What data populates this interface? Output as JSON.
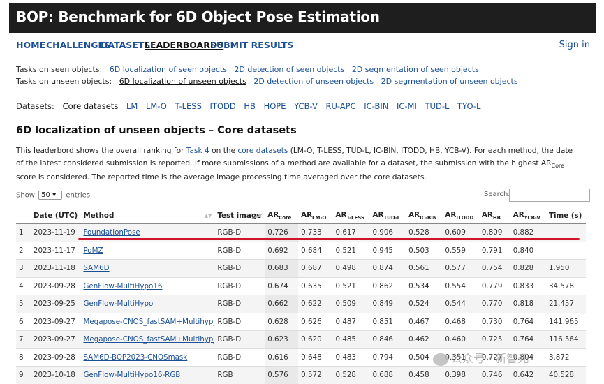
{
  "header": {
    "title": "BOP: Benchmark for 6D Object Pose Estimation"
  },
  "nav": {
    "items": [
      "HOME",
      "CHALLENGES",
      "DATASETS",
      "LEADERBOARDS",
      "SUBMIT RESULTS"
    ],
    "active": "LEADERBOARDS",
    "signin": "Sign in"
  },
  "tasks": {
    "seen_label": "Tasks on seen objects:",
    "seen": [
      "6D localization of seen objects",
      "2D detection of seen objects",
      "2D segmentation of seen objects"
    ],
    "unseen_label": "Tasks on unseen objects:",
    "unseen": [
      "6D localization of unseen objects",
      "2D detection of unseen objects",
      "2D segmentation of unseen objects"
    ]
  },
  "datasets": {
    "label": "Datasets:",
    "items": [
      "Core datasets",
      "LM",
      "LM-O",
      "T-LESS",
      "ITODD",
      "HB",
      "HOPE",
      "YCB-V",
      "RU-APC",
      "IC-BIN",
      "IC-MI",
      "TUD-L",
      "TYO-L"
    ]
  },
  "section_title": "6D localization of unseen objects – Core datasets",
  "description": {
    "p1": "This leaderbord shows the overall ranking for ",
    "link1": "Task 4",
    "p2": " on the ",
    "link2": "core datasets",
    "p3": " (LM-O, T-LESS, TUD-L, IC-BIN, ITODD, HB, YCB-V). For each method, the date of the latest considered submission is reported. If more submissions of a method are available for a dataset, the submission with the highest AR",
    "sub": "Core",
    "p4": " score is considered. The reported time is the average image processing time averaged over the core datasets."
  },
  "controls": {
    "show_label": "Show",
    "entries_value": "50",
    "entries_label": "entries",
    "search_label": "Search:"
  },
  "table": {
    "headers": [
      {
        "main": "",
        "sub": ""
      },
      {
        "main": "Date (UTC)",
        "sub": ""
      },
      {
        "main": "Method",
        "sub": ""
      },
      {
        "main": "Test image",
        "sub": ""
      },
      {
        "main": "AR",
        "sub": "Core"
      },
      {
        "main": "AR",
        "sub": "LM-O"
      },
      {
        "main": "AR",
        "sub": "T-LESS"
      },
      {
        "main": "AR",
        "sub": "TUD-L"
      },
      {
        "main": "AR",
        "sub": "IC-BIN"
      },
      {
        "main": "AR",
        "sub": "ITODD"
      },
      {
        "main": "AR",
        "sub": "HB"
      },
      {
        "main": "AR",
        "sub": "YCB-V"
      },
      {
        "main": "Time (s)",
        "sub": ""
      }
    ],
    "rows": [
      [
        "1",
        "2023-11-19",
        "FoundationPose",
        "RGB-D",
        "0.726",
        "0.733",
        "0.617",
        "0.906",
        "0.528",
        "0.609",
        "0.809",
        "0.882",
        ""
      ],
      [
        "2",
        "2023-11-17",
        "PoMZ",
        "RGB-D",
        "0.692",
        "0.684",
        "0.521",
        "0.945",
        "0.503",
        "0.559",
        "0.791",
        "0.840",
        ""
      ],
      [
        "3",
        "2023-11-18",
        "SAM6D",
        "RGB-D",
        "0.683",
        "0.687",
        "0.498",
        "0.874",
        "0.561",
        "0.577",
        "0.754",
        "0.828",
        "1.950"
      ],
      [
        "4",
        "2023-09-28",
        "GenFlow-MultiHypo16",
        "RGB-D",
        "0.674",
        "0.635",
        "0.521",
        "0.862",
        "0.534",
        "0.554",
        "0.779",
        "0.833",
        "34.578"
      ],
      [
        "5",
        "2023-09-25",
        "GenFlow-MultiHypo",
        "RGB-D",
        "0.662",
        "0.622",
        "0.509",
        "0.849",
        "0.524",
        "0.544",
        "0.770",
        "0.818",
        "21.457"
      ],
      [
        "6",
        "2023-09-27",
        "Megapose-CNOS_fastSAM+Multihyp_Te...",
        "RGB-D",
        "0.628",
        "0.626",
        "0.487",
        "0.851",
        "0.467",
        "0.468",
        "0.730",
        "0.764",
        "141.965"
      ],
      [
        "7",
        "2023-09-27",
        "Megapose-CNOS_fastSAM+Multihyp_Te...",
        "RGB-D",
        "0.623",
        "0.620",
        "0.485",
        "0.846",
        "0.462",
        "0.460",
        "0.725",
        "0.764",
        "116.564"
      ],
      [
        "8",
        "2023-09-28",
        "SAM6D-BOP2023-CNOSmask",
        "RGB-D",
        "0.616",
        "0.648",
        "0.483",
        "0.794",
        "0.504",
        "0.351",
        "0.727",
        "0.804",
        "3.872"
      ],
      [
        "9",
        "2023-10-18",
        "GenFlow-MultiHypo16-RGB",
        "RGB",
        "0.576",
        "0.572",
        "0.528",
        "0.688",
        "0.458",
        "0.398",
        "0.746",
        "0.642",
        "40.528"
      ]
    ]
  },
  "watermark": "公众号 · 新智元"
}
